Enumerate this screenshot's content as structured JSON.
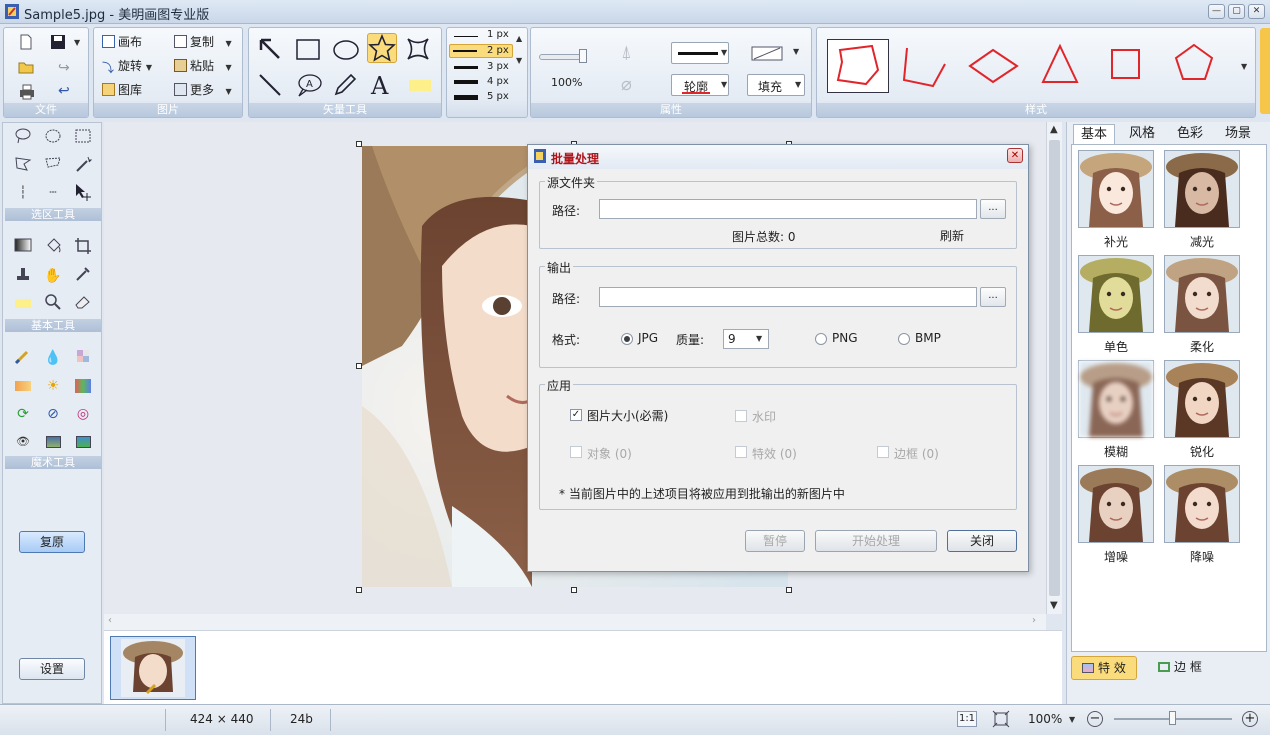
{
  "window": {
    "title": "Sample5.jpg - 美明画图专业版"
  },
  "ribbon": {
    "file_group": {
      "label": "文件"
    },
    "image_group": {
      "label": "图片",
      "canvas": "画布",
      "rotate": "旋转",
      "gallery": "图库",
      "copy": "复制",
      "paste": "粘贴",
      "more": "更多"
    },
    "vector_group": {
      "label": "矢量工具"
    },
    "width_group": {
      "widths": [
        "1 px",
        "2 px",
        "3 px",
        "4 px",
        "5 px"
      ],
      "selected": "2 px"
    },
    "attr_group": {
      "label": "属性",
      "zoom": "100%",
      "outline": "轮廓",
      "fill": "填充"
    },
    "style_group": {
      "label": "样式"
    }
  },
  "toolbox": {
    "select_label": "选区工具",
    "basic_label": "基本工具",
    "magic_label": "魔术工具",
    "restore": "复原",
    "settings": "设置"
  },
  "dialog": {
    "title": "批量处理",
    "source": {
      "legend": "源文件夹",
      "path_label": "路径:",
      "path_value": "",
      "browse": "...",
      "count_text": "图片总数: 0",
      "refresh": "刷新"
    },
    "output": {
      "legend": "输出",
      "path_label": "路径:",
      "path_value": "",
      "browse": "...",
      "format_label": "格式:",
      "jpg": "JPG",
      "quality_label": "质量:",
      "quality_value": "9",
      "png": "PNG",
      "bmp": "BMP",
      "selected_format": "JPG"
    },
    "apply": {
      "legend": "应用",
      "image_size": "图片大小(必需)",
      "watermark": "水印",
      "object": "对象 (0)",
      "effects": "特效 (0)",
      "border": "边框 (0)",
      "note": "* 当前图片中的上述项目将被应用到批输出的新图片中"
    },
    "buttons": {
      "pause": "暂停",
      "start": "开始处理",
      "close": "关闭"
    }
  },
  "right_panel": {
    "tabs": [
      "基本",
      "风格",
      "色彩",
      "场景"
    ],
    "active_tab": "基本",
    "effects": [
      "补光",
      "减光",
      "单色",
      "柔化",
      "模糊",
      "锐化",
      "增噪",
      "降噪"
    ],
    "bottom_tabs": {
      "effects": "特 效",
      "border": "边 框"
    }
  },
  "statusbar": {
    "dimensions": "424 × 440",
    "depth": "24b",
    "ratio": "1:1",
    "zoom": "100%"
  },
  "colors": {
    "accent": "#f5c64a",
    "shape_red": "#e0262b",
    "title_red": "#b0141a",
    "ribbon_bg": "#dde6f1"
  }
}
